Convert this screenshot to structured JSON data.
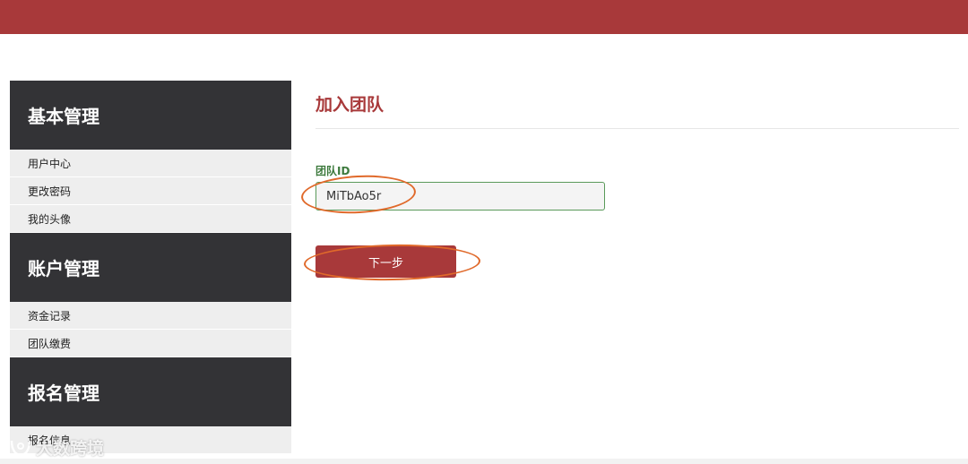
{
  "sidebar": {
    "sections": [
      {
        "title": "基本管理",
        "items": [
          "用户中心",
          "更改密码",
          "我的头像"
        ]
      },
      {
        "title": "账户管理",
        "items": [
          "资金记录",
          "团队缴费"
        ]
      },
      {
        "title": "报名管理",
        "items": [
          "报名信息"
        ]
      }
    ]
  },
  "main": {
    "title": "加入团队",
    "form": {
      "team_id_label": "团队ID",
      "team_id_value": "MiTbAo5r",
      "next_button": "下一步"
    }
  },
  "colors": {
    "brand": "#a8393a",
    "sidebar_header": "#333336",
    "label_green": "#3d7a3d",
    "annotation": "#e0692a"
  },
  "watermark": {
    "text": "大数跨境"
  }
}
